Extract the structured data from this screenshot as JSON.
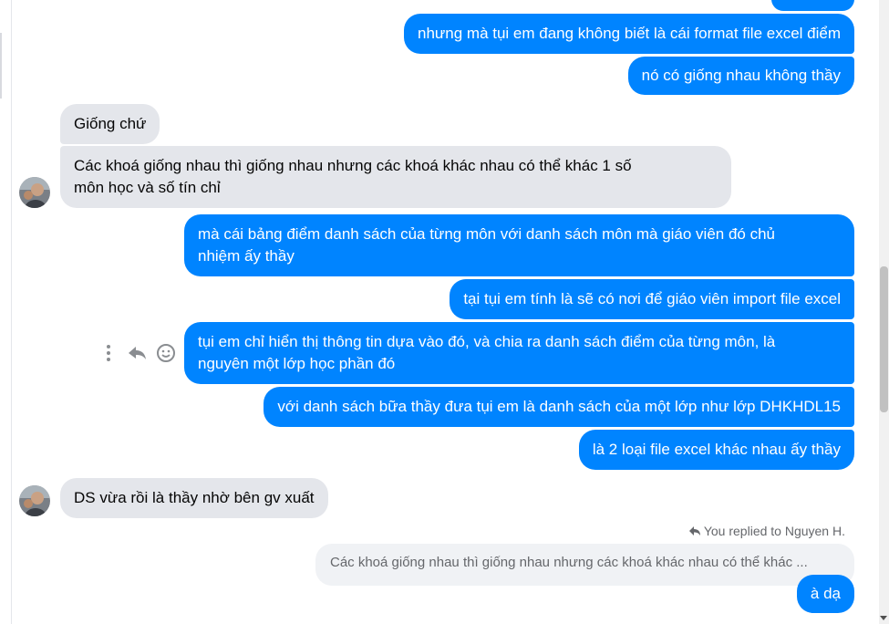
{
  "messages": {
    "m1": "nhưng mà tụi em đang không biết là cái format file excel điểm",
    "m2": "nó có giống nhau không thầy",
    "m3": "Giống chứ",
    "m4_line1": "Các khoá giống nhau thì giống nhau nhưng các khoá khác nhau có thể khác 1 số",
    "m4_line2": "môn học và số tín chỉ",
    "m5_line1": "mà cái bảng điểm danh sách của từng môn với danh sách môn mà giáo viên đó chủ",
    "m5_line2": "nhiệm ấy thầy",
    "m6": "tại tụi em tính là sẽ có nơi để giáo viên import file excel",
    "m7_line1": "tụi em chỉ hiển thị thông tin dựa vào đó, và chia ra danh sách điểm của từng môn, là",
    "m7_line2": "nguyên một lớp học phần đó",
    "m8": "với danh sách bữa thầy đưa tụi em là danh sách của một lớp như lớp DHKHDL15",
    "m9": "là 2 loại file excel khác nhau ấy thầy",
    "m10": "DS vừa rồi là thầy nhờ bên gv xuất",
    "reply_label": "You replied to Nguyen H.",
    "reply_quote": "Các khoá giống nhau thì giống nhau nhưng các khoá khác nhau có thể khác ...",
    "m11": "à dạ"
  },
  "colors": {
    "outgoing": "#0084ff",
    "incoming": "#e4e6eb",
    "muted_text": "#65676b"
  },
  "icons": [
    "more-options-icon",
    "reply-icon",
    "emoji-reaction-icon",
    "reply-arrow-icon",
    "avatar"
  ]
}
